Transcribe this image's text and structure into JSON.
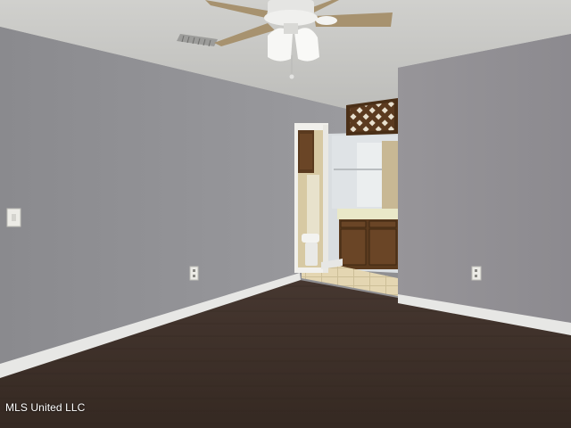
{
  "watermark": {
    "text": "MLS United LLC"
  },
  "colors": {
    "wall": "#8e8e92",
    "wall_right": "#918f94",
    "ceiling": "#c9c9c6",
    "floor": "#3b2e26",
    "baseboard": "#e7e7e5",
    "cabinet": "#5a3a1e",
    "bathroom_tile": "#e6d8b4",
    "fan_blade": "#a7926f"
  },
  "icons": {
    "ceiling_fan": "ceiling-fan-icon",
    "air_vent": "air-vent-icon",
    "light_switch": "light-switch-icon",
    "power_outlet": "power-outlet-icon"
  }
}
